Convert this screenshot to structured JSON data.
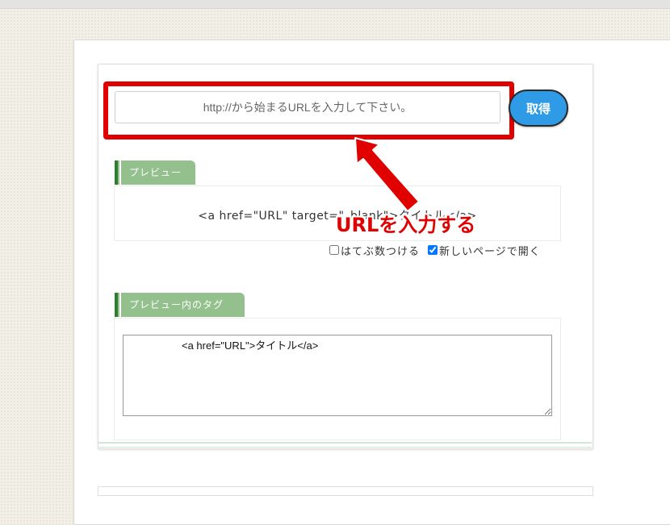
{
  "form": {
    "url_placeholder": "http://から始まるURLを入力して下さい。",
    "url_value": "",
    "fetch_button_label": "取得"
  },
  "preview": {
    "tab_label": "プレビュー",
    "text": "<a href=\"URL\" target=\"_blank\">タイトル</a>"
  },
  "options": {
    "hatebu_label": "はてぶ数つける",
    "hatebu_checked": false,
    "new_page_label": "新しいページで開く",
    "new_page_checked": true
  },
  "tag": {
    "tab_label": "プレビュー内のタグ",
    "code": "<a href=\"URL\">タイトル</a>"
  },
  "annotation": {
    "text": "URLを入力する",
    "color": "#e00000"
  }
}
